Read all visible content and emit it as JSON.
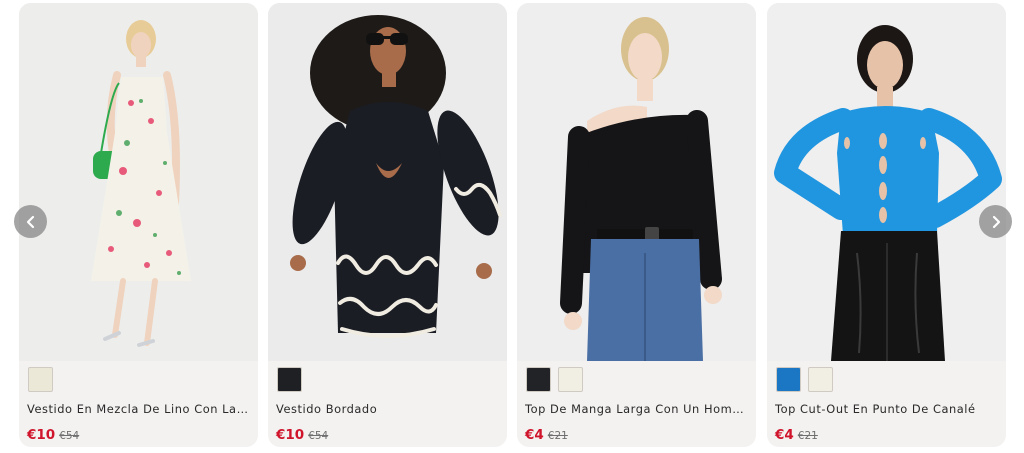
{
  "carousel": {
    "prev_icon": "chevron-left-icon",
    "next_icon": "chevron-right-icon",
    "products": [
      {
        "name": "Vestido En Mezcla De Lino Con Lazo D…",
        "price": "€10",
        "old_price": "€54",
        "swatches": [
          "#ece8d8"
        ],
        "garment_color": "#f4f2e8",
        "accent_color": "#e85a7a"
      },
      {
        "name": "Vestido Bordado",
        "price": "€10",
        "old_price": "€54",
        "swatches": [
          "#1f2024"
        ],
        "garment_color": "#1b1d25",
        "accent_color": "#f0ece2"
      },
      {
        "name": "Top De Manga Larga Con Un Hombro …",
        "price": "€4",
        "old_price": "€21",
        "swatches": [
          "#222327",
          "#f1eee4"
        ],
        "garment_color": "#151517",
        "accent_color": "#4a6fa5"
      },
      {
        "name": "Top Cut-Out En Punto De Canalé",
        "price": "€4",
        "old_price": "€21",
        "swatches": [
          "#1b76c4",
          "#f1eee4"
        ],
        "garment_color": "#2196e0",
        "accent_color": "#141414"
      }
    ]
  }
}
